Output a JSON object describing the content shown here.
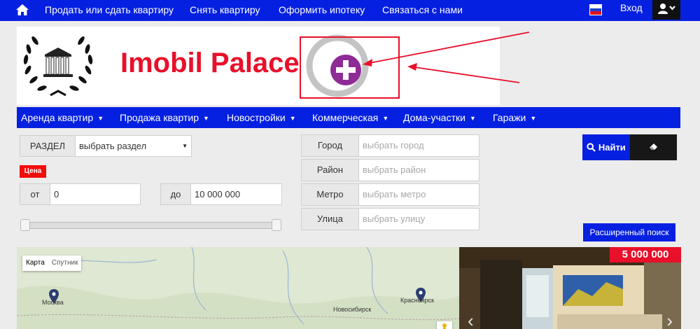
{
  "topbar": {
    "nav": [
      {
        "label": "Продать или сдать квартиру"
      },
      {
        "label": "Снять квартиру"
      },
      {
        "label": "Оформить ипотеку"
      },
      {
        "label": "Связаться с нами"
      }
    ],
    "login_label": "Вход"
  },
  "banner": {
    "brand": "Imobil Palace"
  },
  "categories": [
    {
      "label": "Аренда квартир"
    },
    {
      "label": "Продажа квартир"
    },
    {
      "label": "Новостройки"
    },
    {
      "label": "Коммерческая"
    },
    {
      "label": "Дома-участки"
    },
    {
      "label": "Гаражи"
    }
  ],
  "search": {
    "section_label": "РАЗДЕЛ",
    "section_value": "выбрать раздел",
    "price_badge": "Цена",
    "from_label": "от",
    "from_value": "0",
    "to_label": "до",
    "to_value": "10 000 000",
    "city_label": "Город",
    "city_placeholder": "выбрать город",
    "district_label": "Район",
    "district_placeholder": "выбрать район",
    "metro_label": "Метро",
    "metro_placeholder": "выбрать метро",
    "street_label": "Улица",
    "street_placeholder": "выбрать улицу",
    "find_label": "Найти",
    "advanced_label": "Расширенный поиск"
  },
  "map": {
    "type_map": "Карта",
    "type_satellite": "Спутник",
    "cities": [
      "Москва",
      "Новосибирск",
      "Красноярск"
    ]
  },
  "listing": {
    "price": "5 000 000"
  },
  "colors": {
    "brand_blue": "#0520e0",
    "accent_red": "#e8102a",
    "add_purple": "#8e2b97"
  },
  "icons": [
    "home-icon",
    "flag-icon",
    "user-icon",
    "plus-icon",
    "search-icon",
    "eraser-icon",
    "map-pin-icon",
    "chevron-left-icon",
    "chevron-right-icon",
    "pegman-icon"
  ]
}
